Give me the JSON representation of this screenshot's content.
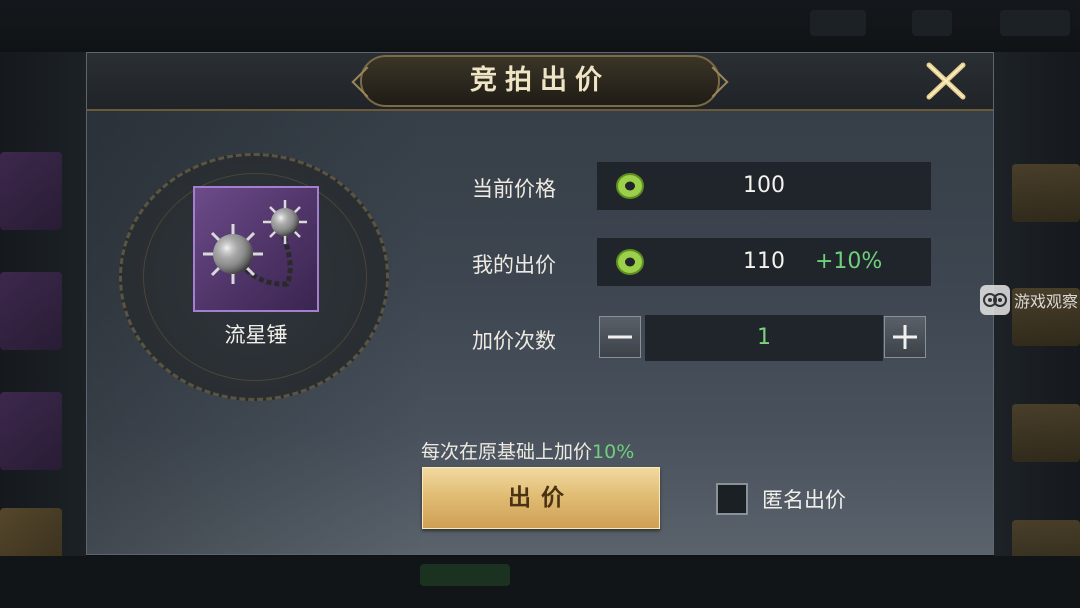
{
  "dialog": {
    "title": "竞拍出价",
    "close_icon": "close-x-icon"
  },
  "item": {
    "name": "流星锤",
    "icon": "meteor-hammer-icon",
    "rarity_color": "#a47fcf"
  },
  "fields": {
    "current_price_label": "当前价格",
    "current_price": "100",
    "my_bid_label": "我的出价",
    "my_bid": "110",
    "my_bid_increase": "+10%",
    "raise_count_label": "加价次数",
    "raise_count": "1",
    "currency_icon": "jade-coin-icon"
  },
  "hint": {
    "text": "每次在原基础上加价",
    "percent": "10%"
  },
  "actions": {
    "bid_label": "出价",
    "anonymous_label": "匿名出价",
    "anonymous_checked": false
  },
  "watermark": {
    "text": "游戏观察"
  },
  "colors": {
    "accent_green": "#6fcf7b",
    "button_gold": "#e1bd75"
  }
}
